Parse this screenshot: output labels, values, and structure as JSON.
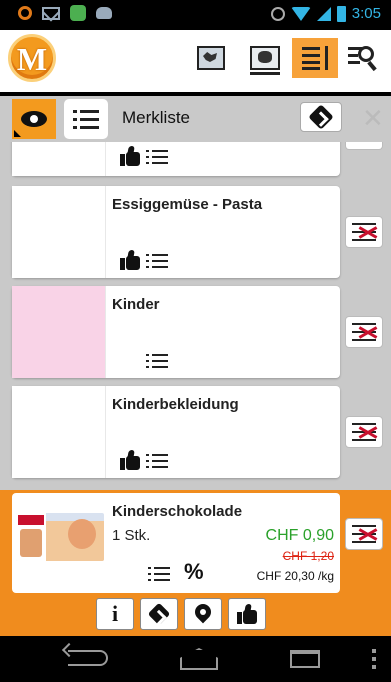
{
  "status_bar": {
    "time": "3:05"
  },
  "logo": {
    "letter": "M"
  },
  "header": {
    "title": "Merkliste"
  },
  "items": [
    {
      "title": "Essiggemüse - Pasta",
      "liked": true
    },
    {
      "title": "Kinder",
      "liked": false
    },
    {
      "title": "Kinderbekleidung",
      "liked": true
    }
  ],
  "selected_item": {
    "title": "Kinderschokolade",
    "quantity": "1 Stk.",
    "price": "CHF 0,90",
    "old_price": "CHF 1,20",
    "unit_price": "CHF 20,30 /kg",
    "discount_symbol": "%"
  },
  "action_buttons": [
    "info-icon",
    "directions-icon",
    "location-pin-icon",
    "thumbs-up-icon"
  ],
  "colors": {
    "accent": "#f08c1e",
    "price_green": "#2aa12a",
    "old_price_red": "#dd2211",
    "delete_red": "#c8102e"
  }
}
